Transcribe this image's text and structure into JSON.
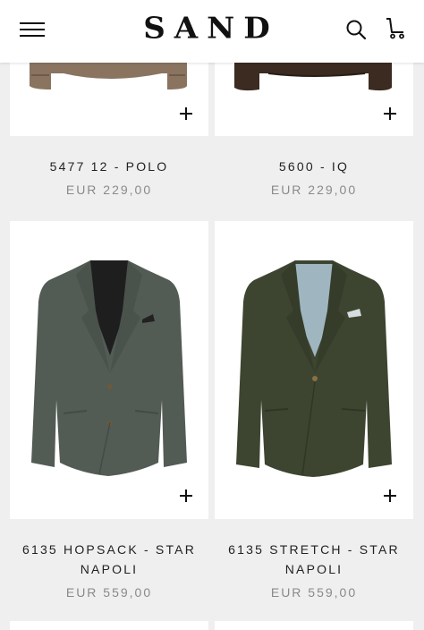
{
  "header": {
    "logo_text": "SAND",
    "menu_icon": "hamburger-menu-icon",
    "search_icon": "search-icon",
    "cart_icon": "shopping-cart-icon"
  },
  "products": [
    {
      "title": "5477 12 - POLO",
      "price": "EUR 229,00",
      "color": "#8a7460"
    },
    {
      "title": "5600 - IQ",
      "price": "EUR 229,00",
      "color": "#3b2b20"
    },
    {
      "title": "6135 HOPSACK - STAR NAPOLI",
      "title_line1": "6135 HOPSACK - STAR",
      "title_line2": "NAPOLI",
      "price": "EUR 559,00",
      "color": "#535b55"
    },
    {
      "title": "6135 STRETCH - STAR NAPOLI",
      "title_line1": "6135 STRETCH - STAR",
      "title_line2": "NAPOLI",
      "price": "EUR 559,00",
      "color": "#3d4530"
    }
  ]
}
